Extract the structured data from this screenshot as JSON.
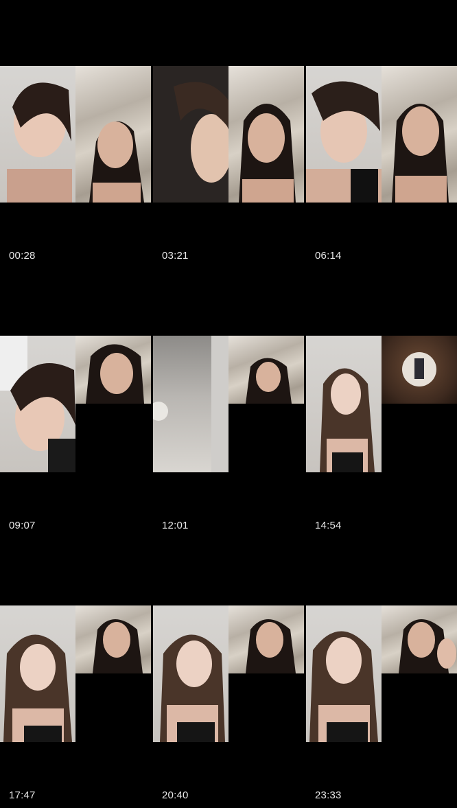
{
  "thumbnails": [
    {
      "time": "00:28",
      "layout": "split",
      "left": "face",
      "right": "face"
    },
    {
      "time": "03:21",
      "layout": "split",
      "left": "face",
      "right": "face"
    },
    {
      "time": "06:14",
      "layout": "split",
      "left": "face",
      "right": "face"
    },
    {
      "time": "09:07",
      "layout": "tall-left",
      "left": "face",
      "right": "face-small"
    },
    {
      "time": "12:01",
      "layout": "tall-left",
      "left": "grey-wall",
      "right": "face-small"
    },
    {
      "time": "14:54",
      "layout": "tall-left",
      "left": "face",
      "right": "circle-avatar"
    },
    {
      "time": "17:47",
      "layout": "tall-left",
      "left": "face",
      "right": "face-small"
    },
    {
      "time": "20:40",
      "layout": "tall-left",
      "left": "face",
      "right": "face-small"
    },
    {
      "time": "23:33",
      "layout": "tall-left",
      "left": "face",
      "right": "face-small"
    }
  ],
  "colors": {
    "background": "#000000",
    "timestamp": "#e8e8e8",
    "divider": "#1e1e1e"
  }
}
